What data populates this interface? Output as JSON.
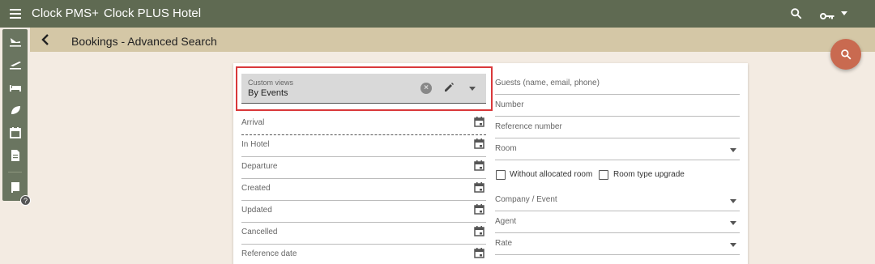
{
  "header": {
    "app_name": "Clock PMS+",
    "hotel_name": "Clock PLUS Hotel"
  },
  "subheader": {
    "title": "Bookings - Advanced Search"
  },
  "custom_views": {
    "label": "Custom views",
    "value": "By Events"
  },
  "left_fields": [
    {
      "label": "Arrival"
    },
    {
      "label": "In Hotel"
    },
    {
      "label": "Departure"
    },
    {
      "label": "Created"
    },
    {
      "label": "Updated"
    },
    {
      "label": "Cancelled"
    },
    {
      "label": "Reference date"
    }
  ],
  "right_fields": {
    "guests": "Guests (name, email, phone)",
    "number": "Number",
    "reference_number": "Reference number",
    "room": "Room",
    "without_allocated_room": "Without allocated room",
    "room_type_upgrade": "Room type upgrade",
    "company_event": "Company / Event",
    "agent": "Agent",
    "rate": "Rate"
  },
  "help_badge": "?",
  "colors": {
    "topbar": "#5f6a52",
    "subbar": "#d4c7a6",
    "fab": "#c96a50",
    "highlight": "#d9383a",
    "background": "#f3ebe2"
  },
  "icons": [
    "menu-icon",
    "search-icon",
    "key-icon",
    "arrow-left-icon",
    "flight-land-icon",
    "flight-takeoff-icon",
    "bed-icon",
    "leaf-icon",
    "calendar-icon",
    "document-icon",
    "book-icon",
    "pencil-icon",
    "clear-icon"
  ]
}
